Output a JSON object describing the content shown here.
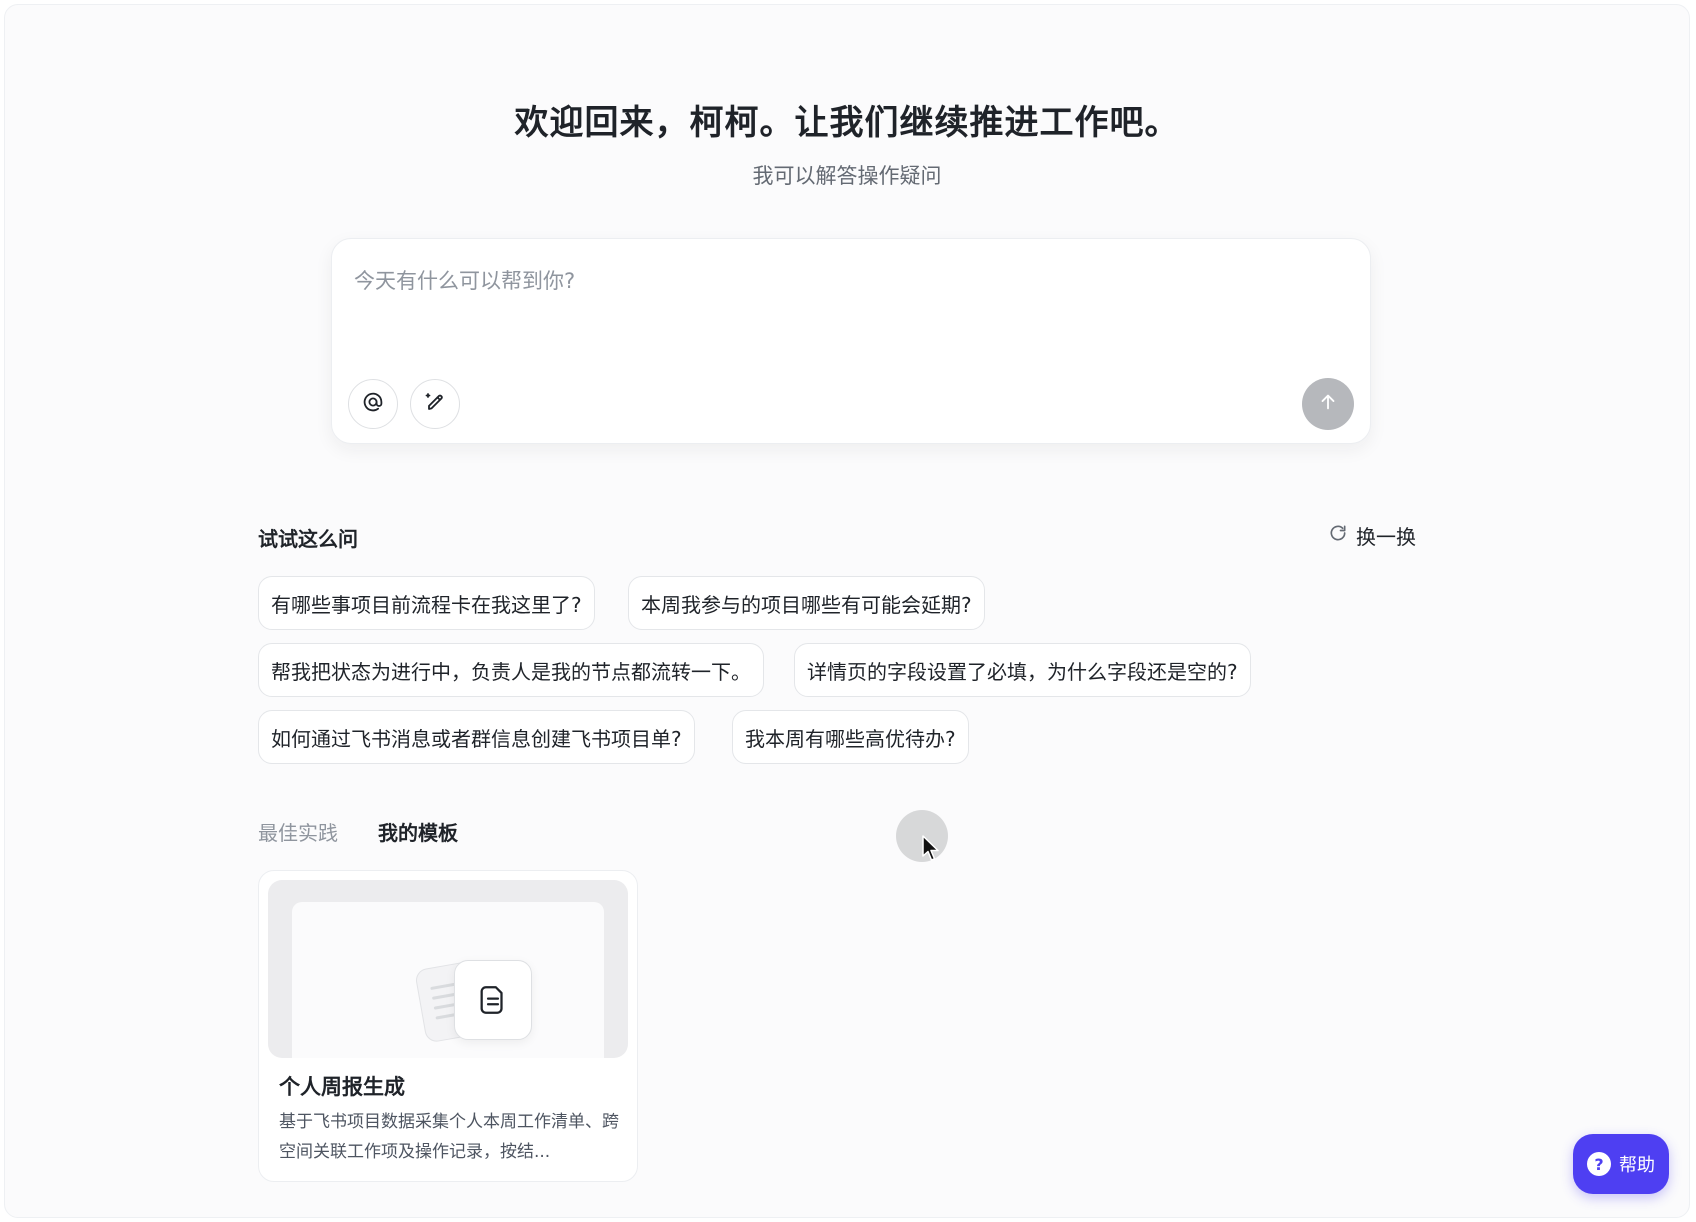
{
  "header": {
    "title": "欢迎回来，柯柯。让我们继续推进工作吧。",
    "subtitle": "我可以解答操作疑问"
  },
  "composer": {
    "placeholder": "今天有什么可以帮到你?",
    "value": "",
    "mention_icon": "at-sign-icon",
    "prompt_icon": "magic-pen-icon",
    "send_icon": "arrow-up-icon"
  },
  "suggestions": {
    "title": "试试这么问",
    "refresh_label": "换一换",
    "refresh_icon": "refresh-icon",
    "items": [
      "有哪些事项目前流程卡在我这里了?",
      "本周我参与的项目哪些有可能会延期?",
      "帮我把状态为进行中，负责人是我的节点都流转一下。",
      "详情页的字段设置了必填，为什么字段还是空的?",
      "如何通过飞书消息或者群信息创建飞书项目单?",
      "我本周有哪些高优待办?"
    ]
  },
  "tabs": [
    {
      "label": "最佳实践",
      "active": false
    },
    {
      "label": "我的模板",
      "active": true
    }
  ],
  "templates": [
    {
      "title": "个人周报生成",
      "description": "基于飞书项目数据采集个人本周工作清单、跨空间关联工作项及操作记录，按结...",
      "icon": "document-icon"
    }
  ],
  "help": {
    "label": "帮助",
    "icon": "question-circle-icon",
    "color": "#4e3ff2"
  }
}
